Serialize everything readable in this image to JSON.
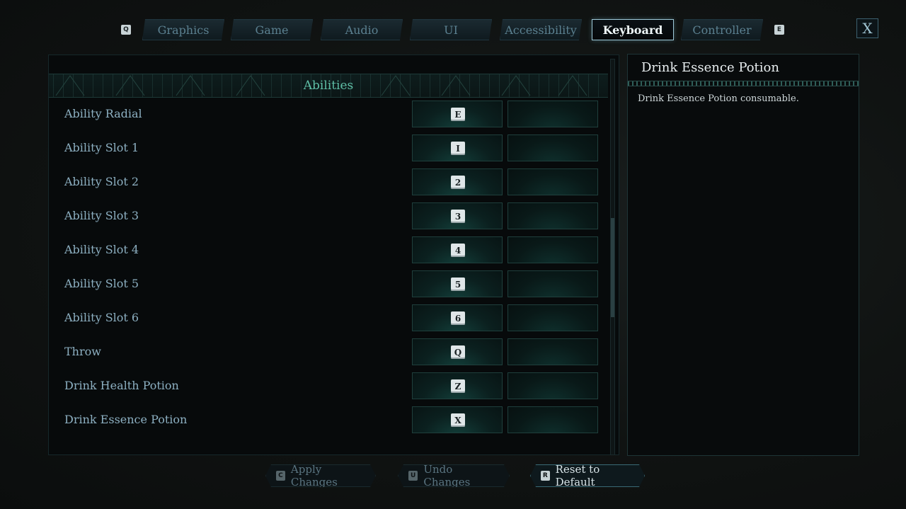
{
  "tabs": {
    "prev_key": "Q",
    "next_key": "E",
    "items": [
      {
        "label": "Graphics",
        "active": false
      },
      {
        "label": "Game",
        "active": false
      },
      {
        "label": "Audio",
        "active": false
      },
      {
        "label": "UI",
        "active": false
      },
      {
        "label": "Accessibility",
        "active": false
      },
      {
        "label": "Keyboard",
        "active": true
      },
      {
        "label": "Controller",
        "active": false
      }
    ],
    "close_label": "X"
  },
  "section": {
    "title": "Abilities"
  },
  "bindings": [
    {
      "label": "Ability Radial",
      "primary": "E",
      "secondary": ""
    },
    {
      "label": "Ability Slot 1",
      "primary": "I",
      "secondary": ""
    },
    {
      "label": "Ability Slot 2",
      "primary": "2",
      "secondary": ""
    },
    {
      "label": "Ability Slot 3",
      "primary": "3",
      "secondary": ""
    },
    {
      "label": "Ability Slot 4",
      "primary": "4",
      "secondary": ""
    },
    {
      "label": "Ability Slot 5",
      "primary": "5",
      "secondary": ""
    },
    {
      "label": "Ability Slot 6",
      "primary": "6",
      "secondary": ""
    },
    {
      "label": "Throw",
      "primary": "Q",
      "secondary": ""
    },
    {
      "label": "Drink Health Potion",
      "primary": "Z",
      "secondary": ""
    },
    {
      "label": "Drink Essence Potion",
      "primary": "X",
      "secondary": ""
    }
  ],
  "info": {
    "title": "Drink Essence Potion",
    "description": "Drink Essence Potion consumable."
  },
  "actions": {
    "apply": {
      "key": "C",
      "label": "Apply Changes"
    },
    "undo": {
      "key": "U",
      "label": "Undo Changes"
    },
    "reset": {
      "key": "R",
      "label": "Reset to Default"
    }
  },
  "colors": {
    "accent_teal": "#5fbfa6",
    "label_blue": "#8db0c2",
    "active_tab_border": "#9ec9d9"
  }
}
